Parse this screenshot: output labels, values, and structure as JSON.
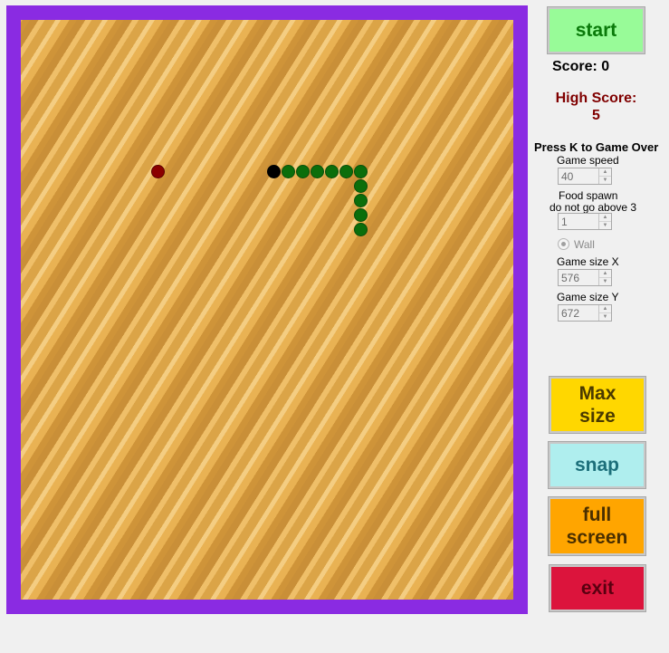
{
  "game": {
    "snake": [
      {
        "col": 17,
        "row": 10,
        "head": true
      },
      {
        "col": 18,
        "row": 10
      },
      {
        "col": 19,
        "row": 10
      },
      {
        "col": 20,
        "row": 10
      },
      {
        "col": 21,
        "row": 10
      },
      {
        "col": 22,
        "row": 10
      },
      {
        "col": 23,
        "row": 10
      },
      {
        "col": 23,
        "row": 11
      },
      {
        "col": 23,
        "row": 12
      },
      {
        "col": 23,
        "row": 13
      },
      {
        "col": 23,
        "row": 14
      }
    ],
    "food": [
      {
        "col": 9,
        "row": 10
      }
    ]
  },
  "controls": {
    "start_label": "start",
    "score_text": "Score: 0",
    "high_score_label": "High Score:",
    "high_score_value": "5",
    "press_k_text": "Press K to Game Over",
    "game_speed_label": "Game speed",
    "game_speed_value": "40",
    "food_spawn_label": "Food spawn",
    "food_spawn_hint": "do not go above 3",
    "food_spawn_value": "1",
    "wall_label": "Wall",
    "game_size_x_label": "Game size X",
    "game_size_x_value": "576",
    "game_size_y_label": "Game size Y",
    "game_size_y_value": "672",
    "max_size_label": "Max\nsize",
    "snap_label": "snap",
    "full_screen_label": "full\nscreen",
    "exit_label": "exit"
  },
  "colors": {
    "border": "#8a2be2",
    "start_bg": "#98fb98",
    "max_size_bg": "#ffd700",
    "snap_bg": "#afeeee",
    "full_screen_bg": "#ffa500",
    "exit_bg": "#dc143c",
    "high_score_text": "#800000"
  }
}
